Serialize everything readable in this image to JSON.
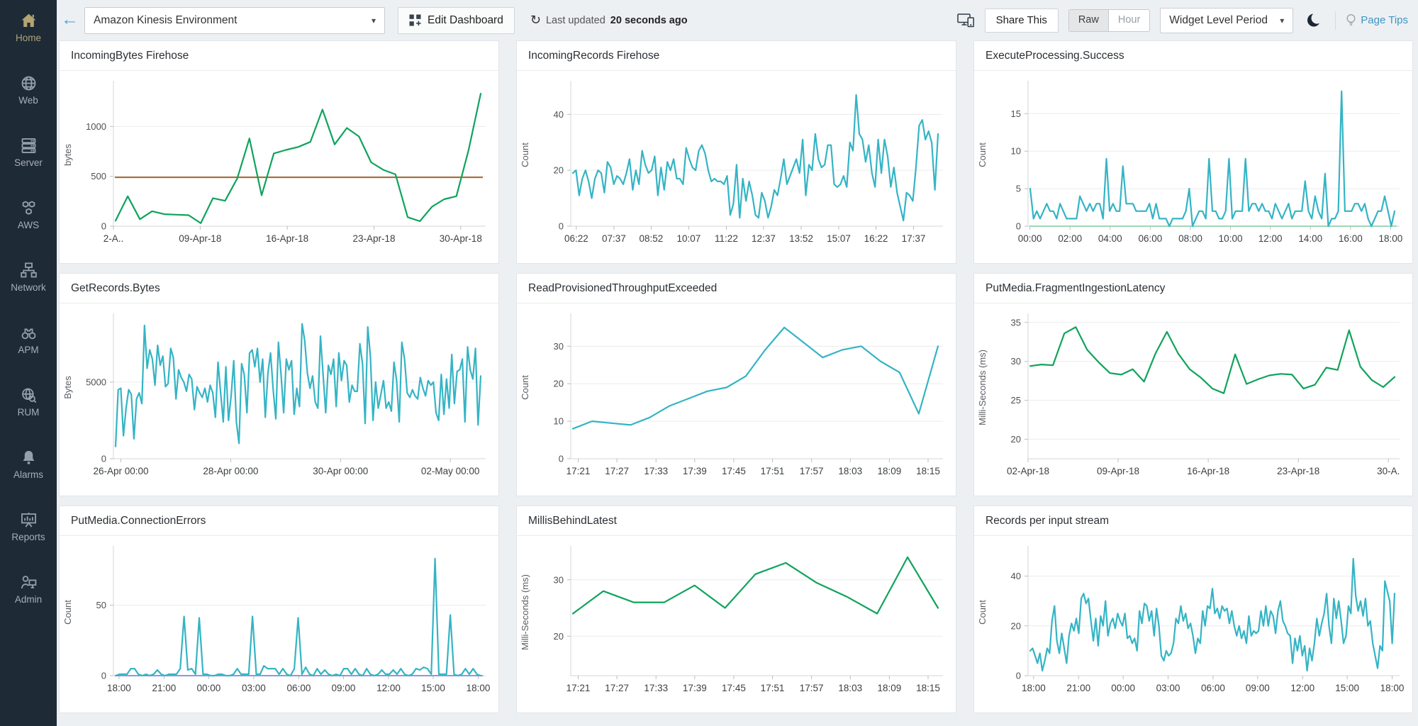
{
  "topbar": {
    "back_arrow": "←",
    "dashboard_select": {
      "value": "Amazon Kinesis Environment"
    },
    "edit_dashboard_label": "Edit Dashboard",
    "refresh_icon": "↻",
    "last_updated_prefix": "Last updated",
    "last_updated_value": "20 seconds ago",
    "share_label": "Share This",
    "toggle": {
      "options": [
        "Raw",
        "Hour"
      ],
      "selected": "Raw"
    },
    "period_select": {
      "value": "Widget Level Period"
    },
    "page_tips_label": "Page Tips"
  },
  "sidebar": {
    "items": [
      {
        "label": "Home",
        "icon": "home-icon",
        "active": true
      },
      {
        "label": "Web",
        "icon": "globe-icon",
        "active": false
      },
      {
        "label": "Server",
        "icon": "server-icon",
        "active": false
      },
      {
        "label": "AWS",
        "icon": "aws-icon",
        "active": false
      },
      {
        "label": "Network",
        "icon": "network-icon",
        "active": false
      },
      {
        "label": "APM",
        "icon": "apm-icon",
        "active": false
      },
      {
        "label": "RUM",
        "icon": "rum-icon",
        "active": false
      },
      {
        "label": "Alarms",
        "icon": "alarms-icon",
        "active": false
      },
      {
        "label": "Reports",
        "icon": "reports-icon",
        "active": false
      },
      {
        "label": "Admin",
        "icon": "admin-icon",
        "active": false
      }
    ]
  },
  "colors": {
    "teal": "#34b4c5",
    "green": "#0fa35c",
    "threshold": "#a4682e",
    "baseline_green": "#8fd2aa",
    "baseline_purple": "#8287d2",
    "grid": "#ececec",
    "axis": "#d3d6d9",
    "tick_text": "#4c5055"
  },
  "chart_data": [
    {
      "type": "line",
      "title": "IncomingBytes Firehose",
      "ylabel": "bytes",
      "yticks": [
        0,
        500,
        1000
      ],
      "ylim": [
        0,
        1430
      ],
      "threshold": 490,
      "xticklabels": [
        "2-A..",
        "09-Apr-18",
        "16-Apr-18",
        "23-Apr-18",
        "30-Apr-18"
      ],
      "xtick_fracs": [
        0.0,
        0.233,
        0.467,
        0.7,
        0.933
      ],
      "color": "#0fa35c",
      "values": [
        55,
        300,
        70,
        150,
        120,
        115,
        110,
        30,
        280,
        255,
        480,
        880,
        310,
        730,
        765,
        795,
        845,
        1170,
        820,
        985,
        900,
        640,
        565,
        520,
        90,
        50,
        195,
        270,
        300,
        760,
        1330
      ]
    },
    {
      "type": "line",
      "title": "IncomingRecords Firehose",
      "ylabel": "Count",
      "yticks": [
        0,
        20,
        40
      ],
      "ylim": [
        0,
        51
      ],
      "xticklabels": [
        "06:22",
        "07:37",
        "08:52",
        "10:07",
        "11:22",
        "12:37",
        "13:52",
        "15:07",
        "16:22",
        "17:37"
      ],
      "xtick_fracs": [
        0.015,
        0.116,
        0.216,
        0.317,
        0.418,
        0.518,
        0.619,
        0.72,
        0.82,
        0.921
      ],
      "color": "#34b4c5",
      "values": [
        19,
        20,
        11,
        17,
        20,
        16,
        10,
        17,
        20,
        19,
        12,
        23,
        21,
        15,
        18,
        17,
        15,
        19,
        24,
        13,
        20,
        15,
        27,
        22,
        19,
        20,
        25,
        11,
        21,
        13,
        23,
        20,
        24,
        17,
        17,
        15,
        28,
        24,
        21,
        20,
        27,
        29,
        26,
        20,
        16,
        17,
        16,
        16,
        15,
        18,
        4,
        8,
        22,
        3,
        17,
        9,
        16,
        11,
        4,
        3,
        12,
        9,
        3,
        7,
        13,
        11,
        17,
        24,
        15,
        18,
        21,
        24,
        19,
        31,
        11,
        22,
        20,
        33,
        24,
        21,
        22,
        29,
        29,
        15,
        14,
        15,
        18,
        14,
        30,
        27,
        47,
        33,
        31,
        23,
        29,
        19,
        14,
        31,
        19,
        31,
        25,
        14,
        21,
        12,
        7,
        2,
        12,
        11,
        9,
        21,
        36,
        38,
        31,
        34,
        30,
        13,
        33
      ]
    },
    {
      "type": "line",
      "title": "ExecuteProcessing.Success",
      "ylabel": "Count",
      "yticks": [
        0,
        5,
        10,
        15
      ],
      "ylim": [
        0,
        19
      ],
      "baseline": {
        "value": 0,
        "color": "#8fd2aa"
      },
      "xticklabels": [
        "00:00",
        "02:00",
        "04:00",
        "06:00",
        "08:00",
        "10:00",
        "12:00",
        "14:00",
        "16:00",
        "18:00"
      ],
      "xtick_fracs": [
        0.005,
        0.113,
        0.221,
        0.329,
        0.437,
        0.545,
        0.652,
        0.76,
        0.868,
        0.976
      ],
      "color": "#34b4c5",
      "values": [
        5,
        1,
        2,
        1,
        2,
        3,
        2,
        2,
        1,
        3,
        2,
        1,
        1,
        1,
        1,
        4,
        3,
        2,
        3,
        2,
        3,
        3,
        1,
        9,
        2,
        3,
        2,
        2,
        8,
        3,
        3,
        3,
        2,
        2,
        2,
        2,
        3,
        1,
        3,
        1,
        1,
        1,
        0,
        1,
        1,
        1,
        1,
        2,
        5,
        0,
        1,
        2,
        2,
        1,
        9,
        2,
        2,
        1,
        1,
        2,
        9,
        1,
        2,
        2,
        2,
        9,
        2,
        3,
        3,
        2,
        3,
        2,
        2,
        1,
        3,
        2,
        1,
        2,
        3,
        1,
        2,
        2,
        2,
        6,
        2,
        1,
        4,
        2,
        1,
        7,
        0,
        1,
        1,
        2,
        18,
        2,
        2,
        2,
        3,
        3,
        2,
        3,
        1,
        0,
        1,
        2,
        2,
        4,
        2,
        0,
        2
      ]
    },
    {
      "type": "line",
      "title": "GetRecords.Bytes",
      "ylabel": "Bytes",
      "yticks": [
        0,
        5000
      ],
      "ylim": [
        0,
        9300
      ],
      "xticklabels": [
        "26-Apr 00:00",
        "28-Apr 00:00",
        "30-Apr 00:00",
        "02-May 00:00"
      ],
      "xtick_fracs": [
        0.02,
        0.315,
        0.61,
        0.905
      ],
      "color": "#34b4c5",
      "values": [
        800,
        4500,
        4600,
        1500,
        3300,
        4500,
        4200,
        1300,
        3900,
        4300,
        3600,
        8700,
        5900,
        7100,
        6500,
        4800,
        7400,
        6100,
        6700,
        4700,
        4900,
        7200,
        6600,
        3900,
        5800,
        5300,
        5000,
        4400,
        5500,
        5200,
        3200,
        4700,
        4300,
        4000,
        4600,
        3700,
        4800,
        4300,
        2700,
        6300,
        4300,
        2400,
        6000,
        2500,
        4100,
        6400,
        2400,
        1000,
        6200,
        5500,
        3000,
        6900,
        7100,
        6000,
        7200,
        5000,
        6500,
        2700,
        5600,
        6900,
        4500,
        2600,
        7600,
        5500,
        3000,
        6500,
        5800,
        6400,
        2900,
        4600,
        3400,
        8800,
        7700,
        5600,
        4600,
        5400,
        3700,
        3300,
        8000,
        5500,
        3000,
        6100,
        5500,
        6500,
        3400,
        6900,
        5100,
        6400,
        6100,
        3700,
        4800,
        4400,
        4400,
        7500,
        6200,
        2300,
        8600,
        6700,
        2500,
        5000,
        3300,
        4200,
        5100,
        3300,
        3700,
        3100,
        6300,
        5100,
        2400,
        7600,
        6500,
        4300,
        4000,
        4500,
        4100,
        3900,
        5300,
        4600,
        4100,
        5100,
        4800,
        5000,
        3000,
        2500,
        5500,
        2900,
        5200,
        3300,
        6800,
        3600,
        5700,
        5800,
        6500,
        2400,
        7300,
        5800,
        5200,
        7200,
        2200,
        5400
      ]
    },
    {
      "type": "line",
      "title": "ReadProvisionedThroughputExceeded",
      "ylabel": "Count",
      "yticks": [
        0,
        10,
        20,
        30
      ],
      "ylim": [
        0,
        38
      ],
      "xticklabels": [
        "17:21",
        "17:27",
        "17:33",
        "17:39",
        "17:45",
        "17:51",
        "17:57",
        "18:03",
        "18:09",
        "18:15"
      ],
      "xtick_fracs": [
        0.02,
        0.124,
        0.229,
        0.333,
        0.438,
        0.542,
        0.647,
        0.751,
        0.856,
        0.96
      ],
      "color": "#34b4c5",
      "values": [
        8,
        10,
        9.5,
        9,
        11,
        14,
        16,
        18,
        19,
        22,
        29,
        35,
        31,
        27,
        29,
        30,
        26,
        23,
        12,
        30
      ]
    },
    {
      "type": "line",
      "title": "PutMedia.FragmentIngestionLatency",
      "ylabel": "Milli-Seconds (ms)",
      "yticks": [
        20,
        25,
        30,
        35
      ],
      "ylim": [
        17.5,
        35.8
      ],
      "xticklabels": [
        "02-Apr-18",
        "09-Apr-18",
        "16-Apr-18",
        "23-Apr-18",
        "30-A."
      ],
      "xtick_fracs": [
        0.0,
        0.2425,
        0.485,
        0.7275,
        0.97
      ],
      "color": "#0fa35c",
      "values": [
        29.4,
        29.6,
        29.5,
        33.6,
        34.4,
        31.5,
        29.9,
        28.5,
        28.3,
        29.0,
        27.4,
        31.0,
        33.8,
        31.0,
        29.0,
        27.9,
        26.5,
        25.9,
        30.9,
        27.1,
        27.7,
        28.2,
        28.4,
        28.3,
        26.5,
        27.0,
        29.2,
        28.9,
        34.0,
        29.3,
        27.6,
        26.7,
        28.0
      ]
    },
    {
      "type": "line",
      "title": "PutMedia.ConnectionErrors",
      "ylabel": "Count",
      "yticks": [
        0,
        50
      ],
      "ylim": [
        0,
        90
      ],
      "baseline": {
        "value": 0,
        "color": "#8287d2"
      },
      "xticklabels": [
        "18:00",
        "21:00",
        "00:00",
        "03:00",
        "06:00",
        "09:00",
        "12:00",
        "15:00",
        "18:00"
      ],
      "xtick_fracs": [
        0.015,
        0.136,
        0.256,
        0.377,
        0.498,
        0.618,
        0.739,
        0.859,
        0.98
      ],
      "color": "#34b4c5",
      "values": [
        0,
        1,
        1,
        1,
        5,
        5,
        1,
        0,
        1,
        0,
        1,
        4,
        1,
        0,
        1,
        1,
        1,
        5,
        42,
        4,
        5,
        1,
        41,
        1,
        1,
        0,
        0,
        1,
        1,
        0,
        0,
        1,
        5,
        1,
        1,
        1,
        42,
        1,
        1,
        7,
        5,
        5,
        5,
        1,
        5,
        1,
        0,
        5,
        41,
        1,
        6,
        1,
        0,
        5,
        1,
        4,
        1,
        0,
        1,
        0,
        5,
        5,
        1,
        5,
        1,
        0,
        5,
        1,
        0,
        1,
        4,
        1,
        1,
        4,
        1,
        5,
        1,
        0,
        1,
        5,
        4,
        6,
        5,
        1,
        83,
        1,
        1,
        1,
        43,
        1,
        0,
        1,
        5,
        1,
        5,
        1,
        0
      ]
    },
    {
      "type": "line",
      "title": "MillisBehindLatest",
      "ylabel": "Milli-Seconds (ms)",
      "yticks": [
        20,
        30
      ],
      "ylim": [
        13,
        35.5
      ],
      "xticklabels": [
        "17:21",
        "17:27",
        "17:33",
        "17:39",
        "17:45",
        "17:51",
        "17:57",
        "18:03",
        "18:09",
        "18:15"
      ],
      "xtick_fracs": [
        0.02,
        0.124,
        0.229,
        0.333,
        0.438,
        0.542,
        0.647,
        0.751,
        0.856,
        0.96
      ],
      "color": "#0fa35c",
      "values": [
        24,
        28,
        26,
        26,
        29,
        25,
        31,
        33,
        29.5,
        27,
        24,
        34,
        25
      ]
    },
    {
      "type": "line",
      "title": "Records per input stream",
      "ylabel": "Count",
      "yticks": [
        0,
        20,
        40
      ],
      "ylim": [
        0,
        51
      ],
      "xticklabels": [
        "18:00",
        "21:00",
        "00:00",
        "03:00",
        "06:00",
        "09:00",
        "12:00",
        "15:00",
        "18:00"
      ],
      "xtick_fracs": [
        0.015,
        0.136,
        0.256,
        0.377,
        0.498,
        0.618,
        0.739,
        0.859,
        0.98
      ],
      "color": "#34b4c5",
      "values": [
        10,
        11,
        8,
        5,
        9,
        2,
        6,
        11,
        9,
        22,
        28,
        14,
        9,
        17,
        11,
        5,
        16,
        21,
        18,
        23,
        17,
        31,
        33,
        29,
        31,
        22,
        14,
        23,
        12,
        24,
        20,
        30,
        16,
        21,
        23,
        19,
        25,
        22,
        20,
        25,
        15,
        16,
        13,
        15,
        10,
        26,
        21,
        29,
        28,
        22,
        26,
        16,
        27,
        20,
        8,
        6,
        10,
        8,
        9,
        13,
        23,
        21,
        28,
        22,
        25,
        19,
        21,
        16,
        9,
        15,
        13,
        26,
        20,
        28,
        27,
        35,
        25,
        27,
        23,
        28,
        26,
        27,
        21,
        26,
        20,
        16,
        20,
        15,
        18,
        13,
        24,
        16,
        18,
        17,
        18,
        26,
        20,
        28,
        20,
        26,
        24,
        17,
        26,
        30,
        22,
        20,
        17,
        16,
        5,
        15,
        10,
        16,
        8,
        12,
        2,
        11,
        6,
        13,
        23,
        16,
        21,
        25,
        33,
        20,
        13,
        31,
        23,
        30,
        22,
        13,
        16,
        28,
        25,
        47,
        32,
        26,
        30,
        24,
        31,
        20,
        22,
        13,
        8,
        3,
        12,
        10,
        38,
        34,
        30,
        13,
        33
      ]
    }
  ]
}
